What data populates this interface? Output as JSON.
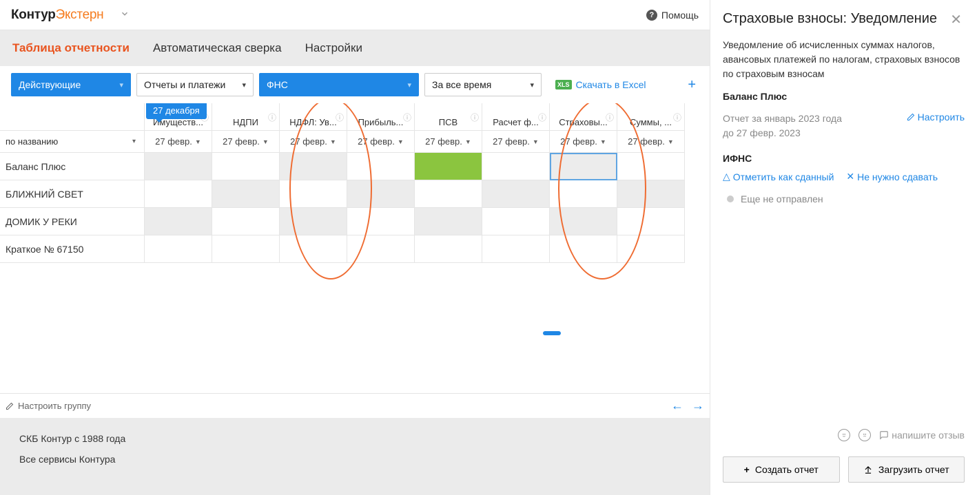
{
  "header": {
    "logo_part1": "Контур",
    "logo_part2": "Экстерн",
    "help": "Помощь"
  },
  "tabs": {
    "t1": "Таблица отчетности",
    "t2": "Автоматическая сверка",
    "t3": "Настройки"
  },
  "filters": {
    "status": "Действующие",
    "type": "Отчеты и платежи",
    "agency": "ФНС",
    "period": "За все время",
    "excel": "Скачать в Excel"
  },
  "badge": "27 декабря",
  "columns": {
    "name_sort": "по названию",
    "c1": "Имуществ...",
    "c2": "НДПИ",
    "c3": "НДФЛ: Ув...",
    "c4": "Прибыль...",
    "c5": "ПСВ",
    "c6": "Расчет ф...",
    "c7": "Страховы...",
    "c8": "Суммы, ...",
    "sub": "27 февр."
  },
  "rows": {
    "r1": "Баланс Плюс",
    "r2": "БЛИЖНИЙ СВЕТ",
    "r3": "ДОМИК У РЕКИ",
    "r4": "Краткое № 67150"
  },
  "bottom": {
    "config": "Настроить группу"
  },
  "footer": {
    "line1": "СКБ Контур с 1988 года",
    "line2": "Все сервисы Контура"
  },
  "panel": {
    "title": "Страховые взносы: Уведомление",
    "desc": "Уведомление об исчисленных суммах налогов, авансовых платежей по налогам, страховых взносов по страховым взносам",
    "company": "Баланс Плюс",
    "period1": "Отчет за январь 2023 года",
    "period2": "до 27 февр. 2023",
    "setup": "Настроить",
    "section": "ИФНС",
    "mark_submitted": "Отметить как сданный",
    "no_need": "Не нужно сдавать",
    "status": "Еще не отправлен",
    "feedback": "напишите отзыв",
    "btn_create": "Создать отчет",
    "btn_upload": "Загрузить отчет"
  }
}
